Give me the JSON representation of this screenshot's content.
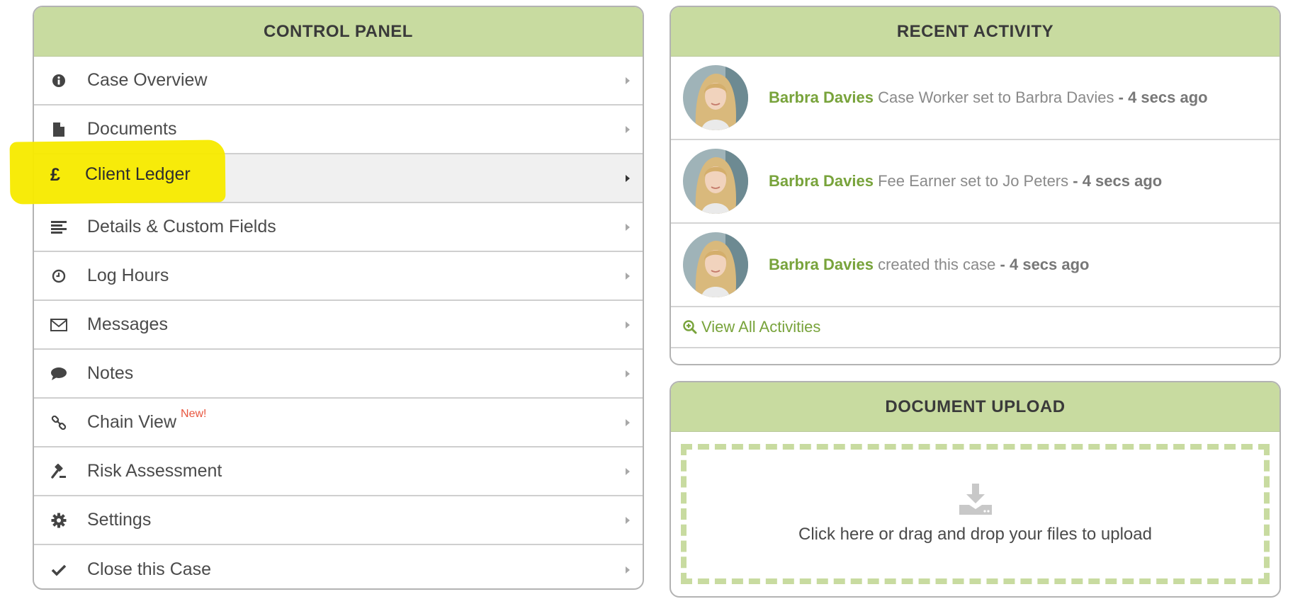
{
  "control_panel": {
    "title": "CONTROL PANEL",
    "items": [
      {
        "label": "Case Overview",
        "icon": "info-icon"
      },
      {
        "label": "Documents",
        "icon": "document-icon"
      },
      {
        "label": "Client Ledger",
        "icon": "pound-icon",
        "icon_glyph": "£",
        "active": true
      },
      {
        "label": "Details & Custom Fields",
        "icon": "details-icon"
      },
      {
        "label": "Log Hours",
        "icon": "clock-icon"
      },
      {
        "label": "Messages",
        "icon": "envelope-icon"
      },
      {
        "label": "Notes",
        "icon": "comment-icon"
      },
      {
        "label": "Chain View",
        "icon": "chain-icon",
        "badge": "New!"
      },
      {
        "label": "Risk Assessment",
        "icon": "gavel-icon"
      },
      {
        "label": "Settings",
        "icon": "gear-icon"
      },
      {
        "label": "Close this Case",
        "icon": "check-icon"
      }
    ]
  },
  "recent_activity": {
    "title": "RECENT ACTIVITY",
    "entries": [
      {
        "user": "Barbra Davies",
        "text": "Case Worker set to Barbra Davies",
        "time": "4 secs ago"
      },
      {
        "user": "Barbra Davies",
        "text": "Fee Earner set to Jo Peters",
        "time": "4 secs ago"
      },
      {
        "user": "Barbra Davies",
        "text": "created this case",
        "time": "4 secs ago"
      }
    ],
    "separator": " - ",
    "view_all_label": "View All Activities"
  },
  "document_upload": {
    "title": "DOCUMENT UPLOAD",
    "prompt": "Click here or drag and drop your files to upload"
  },
  "colors": {
    "header_green": "#c8dba0",
    "accent_green": "#78a33b",
    "highlight_yellow": "#f7ea00",
    "badge_red": "#e8553e"
  }
}
